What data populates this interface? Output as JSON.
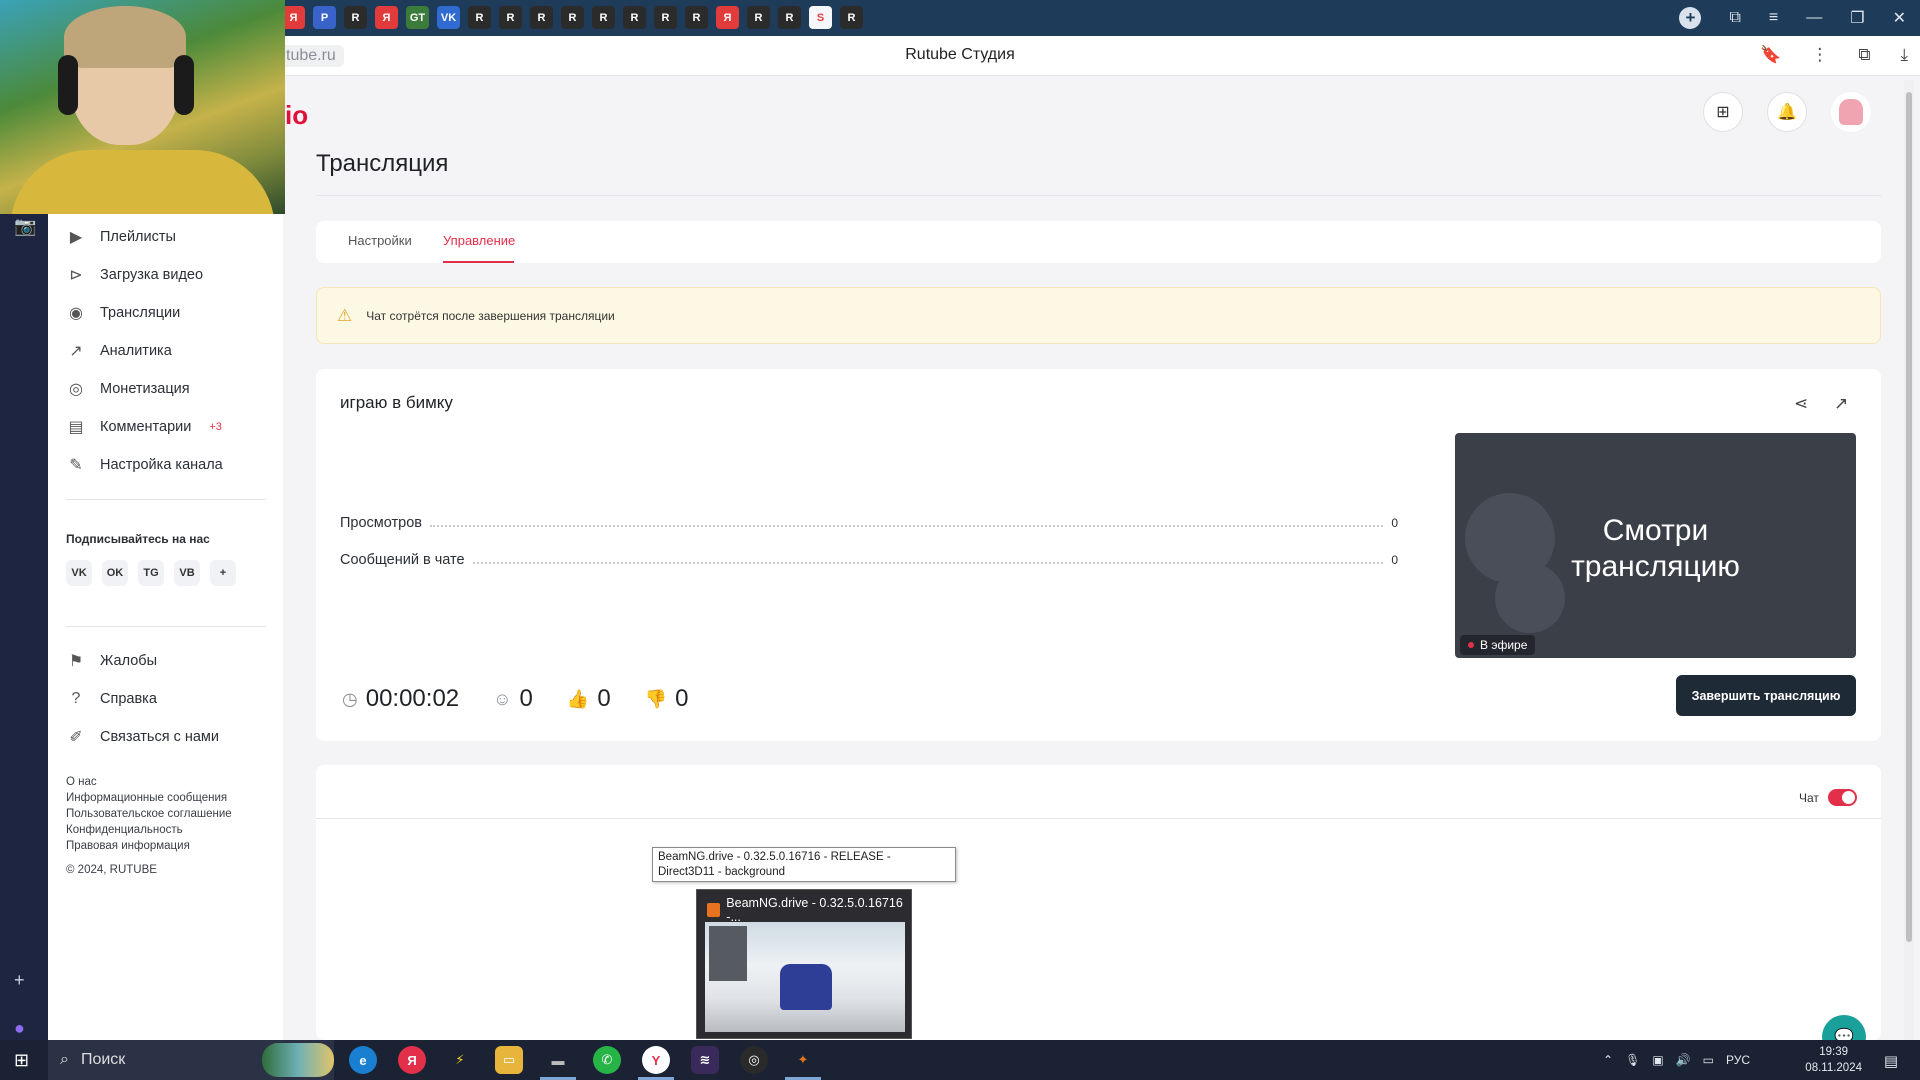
{
  "browser": {
    "url_fragment": "tube.ru",
    "page_title": "Rutube Студия",
    "tab_icons": [
      "Я",
      "P",
      "R",
      "Я",
      "GT",
      "VK",
      "R",
      "R",
      "R",
      "R",
      "R",
      "R",
      "R",
      "R",
      "Я",
      "R",
      "R",
      "S",
      "R"
    ],
    "active_tab_icon": "S"
  },
  "logo_fragment": "io",
  "header": {
    "upload_icon": "plus-square-icon",
    "notifications_icon": "bell-icon"
  },
  "sidebar": {
    "items": [
      {
        "label": "Плейлисты",
        "icon": "playlist-icon"
      },
      {
        "label": "Загрузка видео",
        "icon": "upload-video-icon"
      },
      {
        "label": "Трансляции",
        "icon": "broadcast-icon"
      },
      {
        "label": "Аналитика",
        "icon": "analytics-icon"
      },
      {
        "label": "Монетизация",
        "icon": "money-icon"
      },
      {
        "label": "Комментарии",
        "icon": "comments-icon",
        "badge": "+3"
      },
      {
        "label": "Настройка канала",
        "icon": "magic-wand-icon"
      }
    ],
    "follow_title": "Подписывайтесь на нас",
    "socials": [
      "VK",
      "OK",
      "TG",
      "VB",
      "+"
    ],
    "bottom_items": [
      {
        "label": "Жалобы",
        "icon": "flag-icon"
      },
      {
        "label": "Справка",
        "icon": "question-icon"
      },
      {
        "label": "Связаться с нами",
        "icon": "pencil-icon"
      }
    ],
    "footer_links": [
      "О нас",
      "Информационные сообщения",
      "Пользовательское соглашение",
      "Конфиденциальность",
      "Правовая информация"
    ],
    "copyright": "© 2024, RUTUBE"
  },
  "main": {
    "title": "Трансляция",
    "tabs": [
      {
        "label": "Настройки",
        "active": false
      },
      {
        "label": "Управление",
        "active": true
      }
    ],
    "alert": "Чат сотрётся после завершения трансляции",
    "stream": {
      "name": "играю в бимку",
      "stats": [
        {
          "label": "Просмотров",
          "value": "0"
        },
        {
          "label": "Сообщений в чате",
          "value": "0"
        }
      ],
      "preview_text_line1": "Смотри",
      "preview_text_line2": "трансляцию",
      "live_label": "В эфире",
      "end_button": "Завершить трансляцию",
      "duration": "00:00:02",
      "viewers": "0",
      "likes": "0",
      "dislikes": "0"
    },
    "chat_label": "Чат",
    "chat_enabled": true
  },
  "overlay": {
    "tooltip": "BeamNG.drive - 0.32.5.0.16716 - RELEASE - Direct3D11 - background",
    "thumb_title": "BeamNG.drive - 0.32.5.0.16716 -..."
  },
  "taskbar": {
    "search_label": "Поиск",
    "lang": "РУС",
    "time": "19:39",
    "date": "08.11.2024"
  },
  "colors": {
    "accent": "#e3304a",
    "dark_button": "#1f2a37",
    "alert_bg": "#fdf8e4"
  }
}
